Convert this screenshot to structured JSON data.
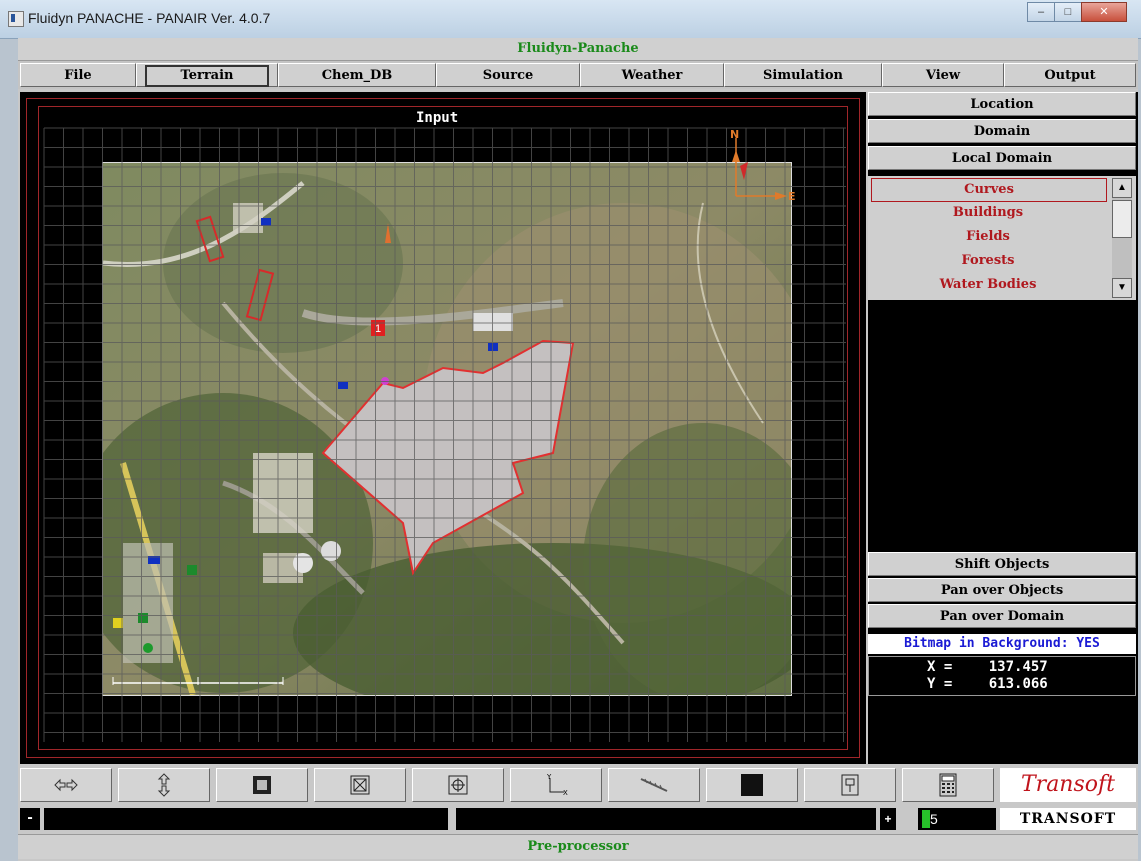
{
  "window": {
    "title": "Fluidyn PANACHE - PANAIR  Ver. 4.0.7"
  },
  "app": {
    "title": "Fluidyn-Panache",
    "footer": "Pre-processor"
  },
  "menubar": [
    "File",
    "Terrain",
    "Chem_DB",
    "Source",
    "Weather",
    "Simulation",
    "View",
    "Output"
  ],
  "menubar_active": "Terrain",
  "viewport": {
    "label": "Input",
    "compass_n": "N",
    "compass_e": "E",
    "marker_number": "1"
  },
  "right_panel": {
    "top_buttons": [
      "Location",
      "Domain",
      "Local Domain"
    ],
    "list_items": [
      "Curves",
      "Buildings",
      "Fields",
      "Forests",
      "Water Bodies"
    ],
    "selected_item": "Curves",
    "bottom_buttons": [
      "Shift Objects",
      "Pan over Objects",
      "Pan over Domain"
    ],
    "bitmap_background": "Bitmap in Background: YES",
    "x_label": "X =",
    "x_value": "137.457",
    "y_label": "Y =",
    "y_value": "613.066"
  },
  "toolbar": {
    "tools": [
      "pan-arrows-icon",
      "zoom-arrows-icon",
      "fit-view-icon",
      "zoom-box-icon",
      "center-target-icon",
      "axes-icon",
      "ruler-icon",
      "fill-black-icon",
      "spray-icon",
      "calculator-icon"
    ],
    "logo": "Transoft"
  },
  "status": {
    "minus": "-",
    "plus": "+",
    "value": "5",
    "brand": "TRANSOFT"
  },
  "colors": {
    "accent_green": "#1a8a1a",
    "list_red": "#b0181e",
    "bitmap_blue": "#1b1bd4"
  }
}
